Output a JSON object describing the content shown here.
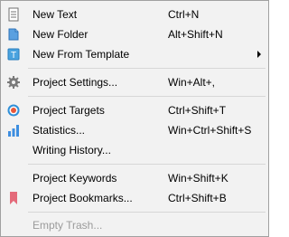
{
  "menu": {
    "items": [
      {
        "label": "New Text",
        "shortcut": "Ctrl+N",
        "icon": "text-document-icon"
      },
      {
        "label": "New Folder",
        "shortcut": "Alt+Shift+N",
        "icon": "folder-icon"
      },
      {
        "label": "New From Template",
        "shortcut": "",
        "icon": "template-icon",
        "submenu": true
      },
      {
        "label": "Project Settings...",
        "shortcut": "Win+Alt+,",
        "icon": "gear-icon"
      },
      {
        "label": "Project Targets",
        "shortcut": "Ctrl+Shift+T",
        "icon": "target-icon"
      },
      {
        "label": "Statistics...",
        "shortcut": "Win+Ctrl+Shift+S",
        "icon": "bar-chart-icon"
      },
      {
        "label": "Writing History...",
        "shortcut": "",
        "icon": ""
      },
      {
        "label": "Project Keywords",
        "shortcut": "Win+Shift+K",
        "icon": ""
      },
      {
        "label": "Project Bookmarks...",
        "shortcut": "Ctrl+Shift+B",
        "icon": "bookmark-icon"
      },
      {
        "label": "Empty Trash...",
        "shortcut": "",
        "icon": "",
        "disabled": true
      }
    ]
  },
  "colors": {
    "menu_background": "#f2f2f2",
    "border": "#a0a0a0",
    "separator": "#d7d7d7",
    "disabled_text": "#9b9b9b",
    "gear": "#7a7a7a",
    "target_outer": "#2f8fd8",
    "target_inner": "#e8583a",
    "chart_bar": "#3d8ee0",
    "bookmark": "#e46a7a"
  }
}
